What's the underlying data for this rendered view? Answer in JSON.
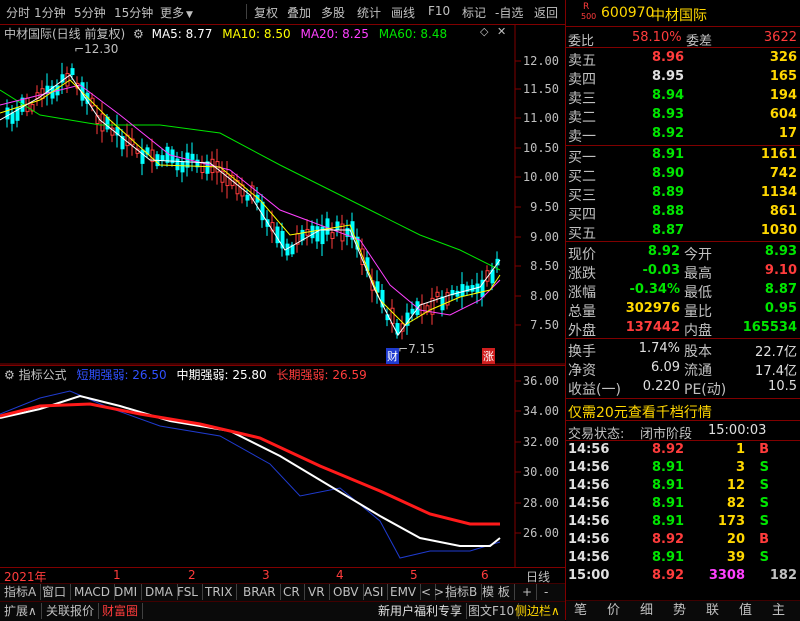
{
  "toolbar": {
    "items": [
      "分时",
      "1分钟",
      "5分钟",
      "15分钟",
      "更多",
      "复权",
      "叠加",
      "多股",
      "统计",
      "画线",
      "F10",
      "标记",
      "-自选",
      "返回"
    ]
  },
  "chart": {
    "title": "中材国际(日线 前复权)",
    "ma5": "MA5: 8.77",
    "ma10": "MA10: 8.50",
    "ma20": "MA20: 8.25",
    "ma60": "MA60: 8.48",
    "high_marker": "12.30",
    "low_marker": "7.15",
    "tag_cai": "财",
    "tag_zhang": "涨",
    "price_axis": [
      "12.00",
      "11.50",
      "11.00",
      "10.50",
      "10.00",
      "9.50",
      "9.00",
      "8.50",
      "8.00",
      "7.50"
    ],
    "colors": {
      "ma5": "#ffffff",
      "ma10": "#ffff00",
      "ma20": "#ff40ff",
      "ma60": "#00e600",
      "up": "#ff3c3c",
      "down": "#00ffff"
    }
  },
  "indicator": {
    "label": "指标公式",
    "short": "短期强弱: 26.50",
    "mid": "中期强弱: 25.80",
    "long": "长期强弱: 26.59",
    "axis": [
      "36.00",
      "34.00",
      "32.00",
      "30.00",
      "28.00",
      "26.00"
    ]
  },
  "time_axis": {
    "labels": [
      "2021年",
      "1",
      "2",
      "3",
      "4",
      "5",
      "6"
    ],
    "right_label": "日线"
  },
  "bottom_tabs": {
    "row1": [
      "指标A",
      "窗口",
      "MACD",
      "DMI",
      "DMA",
      "FSL",
      "TRIX",
      "BRAR",
      "CR",
      "VR",
      "OBV",
      "ASI",
      "EMV",
      "<",
      ">",
      "指标B",
      "模 板",
      "+",
      "-"
    ],
    "row2": [
      "扩展∧",
      "关联报价",
      "财富圈"
    ],
    "row2_right": [
      "新用户福利专享",
      "图文F10",
      "侧边栏"
    ]
  },
  "quote": {
    "logo": "R",
    "logo_sub": "500",
    "code": "600970",
    "name": "中材国际",
    "webi_label": "委比",
    "webi": "58.10%",
    "weicha_label": "委差",
    "weicha": "3622",
    "sells": [
      {
        "label": "卖五",
        "price": "8.96",
        "vol": "326"
      },
      {
        "label": "卖四",
        "price": "8.95",
        "vol": "165"
      },
      {
        "label": "卖三",
        "price": "8.94",
        "vol": "194"
      },
      {
        "label": "卖二",
        "price": "8.93",
        "vol": "604"
      },
      {
        "label": "卖一",
        "price": "8.92",
        "vol": "17"
      }
    ],
    "buys": [
      {
        "label": "买一",
        "price": "8.91",
        "vol": "1161"
      },
      {
        "label": "买二",
        "price": "8.90",
        "vol": "742"
      },
      {
        "label": "买三",
        "price": "8.89",
        "vol": "1134"
      },
      {
        "label": "买四",
        "price": "8.88",
        "vol": "861"
      },
      {
        "label": "买五",
        "price": "8.87",
        "vol": "1030"
      }
    ],
    "stats": [
      {
        "l1": "现价",
        "v1": "8.92",
        "l2": "今开",
        "v2": "8.93"
      },
      {
        "l1": "涨跌",
        "v1": "-0.03",
        "l2": "最高",
        "v2": "9.10"
      },
      {
        "l1": "涨幅",
        "v1": "-0.34%",
        "l2": "最低",
        "v2": "8.87"
      },
      {
        "l1": "总量",
        "v1": "302976",
        "l2": "量比",
        "v2": "0.95"
      },
      {
        "l1": "外盘",
        "v1": "137442",
        "l2": "内盘",
        "v2": "165534"
      }
    ],
    "stats2": [
      {
        "l1": "换手",
        "v1": "1.74%",
        "l2": "股本",
        "v2": "22.7亿"
      },
      {
        "l1": "净资",
        "v1": "6.09",
        "l2": "流通",
        "v2": "17.4亿"
      },
      {
        "l1": "收益(一)",
        "v1": "0.220",
        "l2": "PE(动)",
        "v2": "10.5"
      }
    ],
    "promo": "仅需20元查看千档行情",
    "trade_status_label": "交易状态:",
    "trade_status": "闭市阶段",
    "trade_time": "15:00:03",
    "ticks": [
      {
        "t": "14:56",
        "p": "8.92",
        "v": "1",
        "d": "B"
      },
      {
        "t": "14:56",
        "p": "8.91",
        "v": "3",
        "d": "S"
      },
      {
        "t": "14:56",
        "p": "8.91",
        "v": "12",
        "d": "S"
      },
      {
        "t": "14:56",
        "p": "8.91",
        "v": "82",
        "d": "S"
      },
      {
        "t": "14:56",
        "p": "8.91",
        "v": "173",
        "d": "S"
      },
      {
        "t": "14:56",
        "p": "8.92",
        "v": "20",
        "d": "B"
      },
      {
        "t": "14:56",
        "p": "8.91",
        "v": "39",
        "d": "S"
      },
      {
        "t": "15:00",
        "p": "8.92",
        "v": "3308",
        "d": "182"
      }
    ],
    "bottom_tabs": [
      "笔",
      "价",
      "细",
      "势",
      "联",
      "值",
      "主"
    ]
  }
}
